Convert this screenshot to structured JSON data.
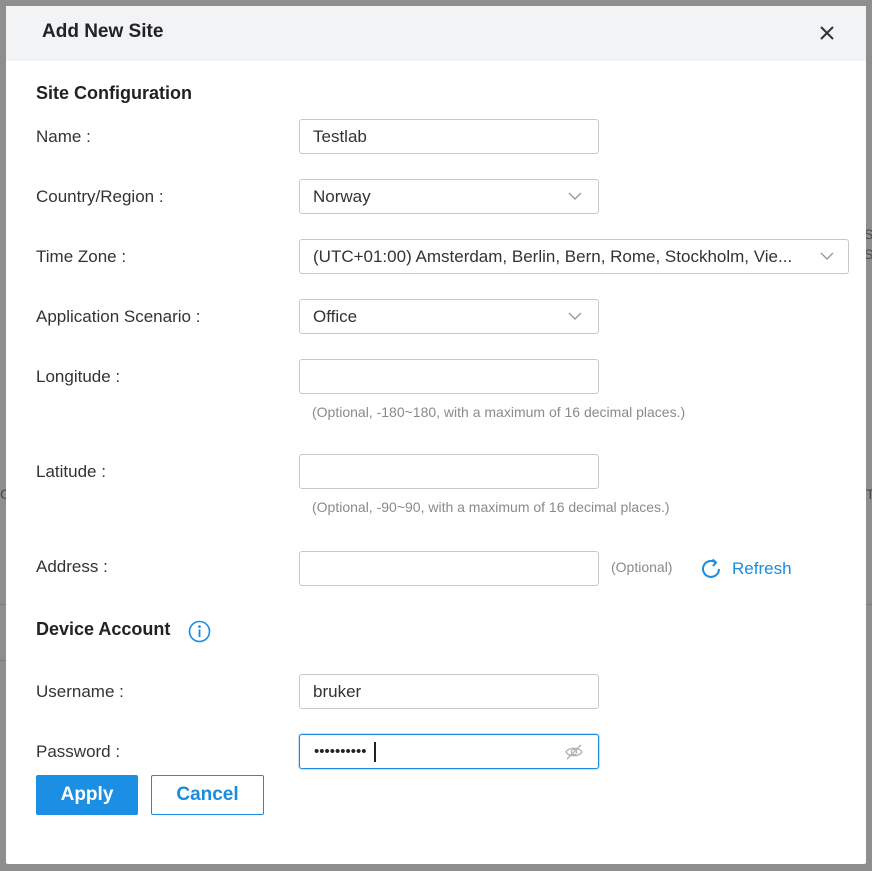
{
  "dialog": {
    "title": "Add New Site",
    "close_icon": "close-icon"
  },
  "site_configuration": {
    "heading": "Site Configuration",
    "name": {
      "label": "Name",
      "value": "Testlab"
    },
    "country": {
      "label": "Country/Region",
      "value": "Norway"
    },
    "time_zone": {
      "label": "Time Zone",
      "value": "(UTC+01:00) Amsterdam, Berlin, Bern, Rome, Stockholm, Vie..."
    },
    "scenario": {
      "label": "Application Scenario",
      "value": "Office"
    },
    "longitude": {
      "label": "Longitude",
      "value": "",
      "hint": "(Optional, -180~180, with a maximum of 16 decimal places.)"
    },
    "latitude": {
      "label": "Latitude",
      "value": "",
      "hint": "(Optional, -90~90, with a maximum of 16 decimal places.)"
    },
    "address": {
      "label": "Address",
      "value": "",
      "optional": "(Optional)",
      "refresh_label": "Refresh"
    }
  },
  "device_account": {
    "heading": "Device Account",
    "username": {
      "label": "Username",
      "value": "bruker"
    },
    "password": {
      "label": "Password",
      "masked_value": "••••••••••"
    }
  },
  "actions": {
    "apply": "Apply",
    "cancel": "Cancel"
  },
  "colors": {
    "accent": "#1a8ce0",
    "header_bg": "#f2f3f5",
    "hint_text": "#8a8a8a"
  }
}
